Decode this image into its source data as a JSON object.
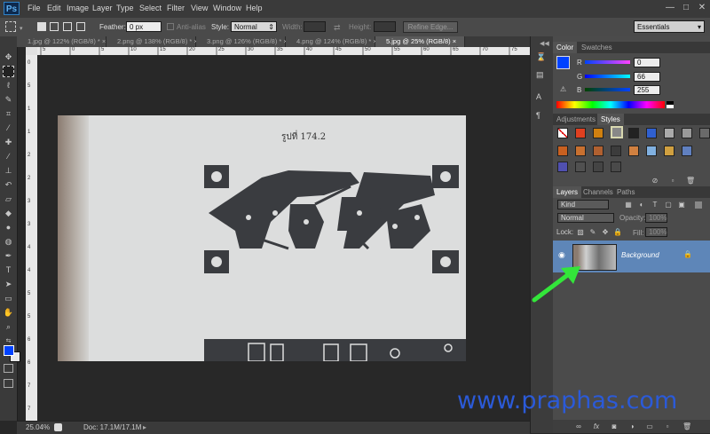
{
  "app": {
    "logo": "Ps"
  },
  "menu": [
    "File",
    "Edit",
    "Image",
    "Layer",
    "Type",
    "Select",
    "Filter",
    "View",
    "Window",
    "Help"
  ],
  "window_controls": {
    "minimize": "—",
    "restore": "□",
    "close": "✕"
  },
  "options": {
    "feather_label": "Feather:",
    "feather_value": "0 px",
    "antialias_label": "Anti-alias",
    "style_label": "Style:",
    "style_value": "Normal",
    "width_label": "Width:",
    "height_label": "Height:",
    "refine_edge": "Refine Edge...",
    "workspace": "Essentials"
  },
  "tabs": [
    {
      "label": "1.jpg @ 122% (RGB/8) *",
      "close": "×"
    },
    {
      "label": "2.png @ 138% (RGB/8) *",
      "close": "×"
    },
    {
      "label": "3.png @ 126% (RGB/8) *",
      "close": "×"
    },
    {
      "label": "4.png @ 124% (RGB/8) *",
      "close": "×"
    },
    {
      "label": "5.jpg @ 25% (RGB/8)",
      "close": "×"
    }
  ],
  "rulers": {
    "top": [
      "5",
      "0",
      "5",
      "10",
      "15",
      "20",
      "25",
      "30",
      "35",
      "40",
      "45",
      "50",
      "55",
      "60",
      "65",
      "70",
      "75"
    ],
    "left": [
      "0",
      "5",
      "1",
      "1",
      "2",
      "2",
      "3",
      "3",
      "4",
      "4",
      "5",
      "5",
      "6",
      "6",
      "7",
      "7"
    ]
  },
  "document": {
    "figure_label": "รูปที่ 174.2"
  },
  "status": {
    "zoom": "25.04%",
    "doc": "Doc: 17.1M/17.1M"
  },
  "color_panel": {
    "tabs": [
      "Color",
      "Swatches"
    ],
    "channels": [
      {
        "name": "R",
        "value": "0"
      },
      {
        "name": "G",
        "value": "66"
      },
      {
        "name": "B",
        "value": "255"
      }
    ],
    "fg_color": "#0042ff"
  },
  "adjust_panel": {
    "tabs": [
      "Adjustments",
      "Styles"
    ]
  },
  "layers_panel": {
    "tabs": [
      "Layers",
      "Channels",
      "Paths"
    ],
    "filter_kind": "Kind",
    "blend_mode": "Normal",
    "opacity_label": "Opacity:",
    "opacity_value": "100%",
    "lock_label": "Lock:",
    "fill_label": "Fill:",
    "fill_value": "100%",
    "layer_name": "Background"
  },
  "watermark": "www.praphas.com"
}
